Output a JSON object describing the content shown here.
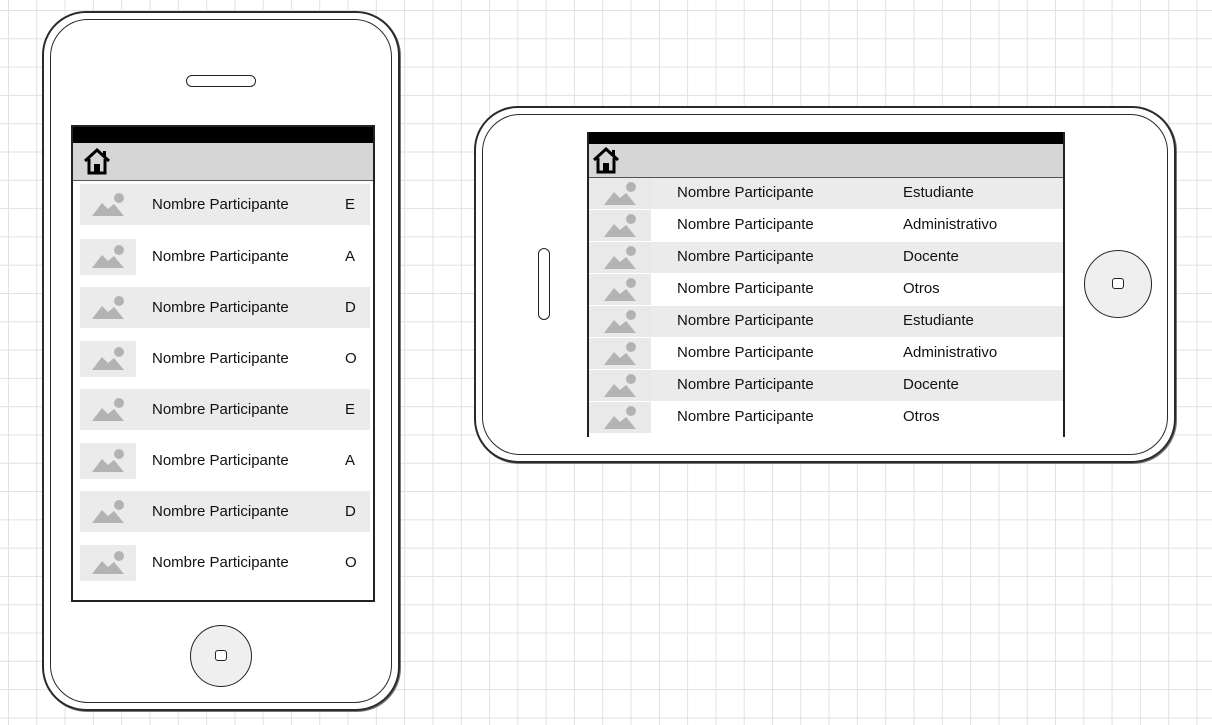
{
  "portrait": {
    "rows": [
      {
        "name": "Nombre Participante",
        "role": "E"
      },
      {
        "name": "Nombre Participante",
        "role": "A"
      },
      {
        "name": "Nombre Participante",
        "role": "D"
      },
      {
        "name": "Nombre Participante",
        "role": "O"
      },
      {
        "name": "Nombre Participante",
        "role": "E"
      },
      {
        "name": "Nombre Participante",
        "role": "A"
      },
      {
        "name": "Nombre Participante",
        "role": "D"
      },
      {
        "name": "Nombre Participante",
        "role": "O"
      }
    ]
  },
  "landscape": {
    "rows": [
      {
        "name": "Nombre Participante",
        "role": "Estudiante"
      },
      {
        "name": "Nombre Participante",
        "role": "Administrativo"
      },
      {
        "name": "Nombre Participante",
        "role": "Docente"
      },
      {
        "name": "Nombre Participante",
        "role": "Otros"
      },
      {
        "name": "Nombre Participante",
        "role": "Estudiante"
      },
      {
        "name": "Nombre Participante",
        "role": "Administrativo"
      },
      {
        "name": "Nombre Participante",
        "role": "Docente"
      },
      {
        "name": "Nombre Participante",
        "role": "Otros"
      }
    ]
  },
  "icons": {
    "home": "home-icon",
    "thumbnail": "image-placeholder-icon",
    "device_home_button": "home-button-icon"
  }
}
